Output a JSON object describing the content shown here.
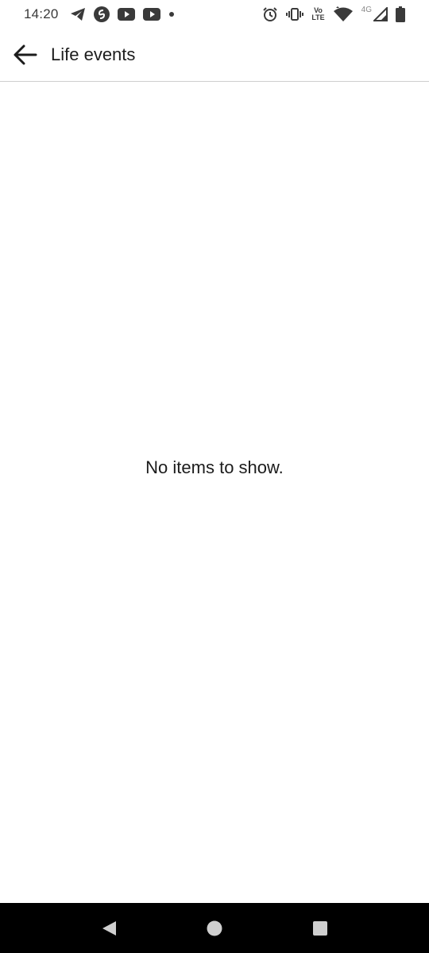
{
  "status_bar": {
    "time": "14:20",
    "volte_top": "Vo",
    "volte_bottom": "LTE",
    "network": "4G"
  },
  "app_bar": {
    "title": "Life events"
  },
  "content": {
    "empty_message": "No items to show."
  },
  "colors": {
    "background": "#ffffff",
    "text": "#1c1c1c",
    "divider": "#cfcfcf",
    "nav_bar": "#000000",
    "nav_icons": "#cfcfcf"
  }
}
